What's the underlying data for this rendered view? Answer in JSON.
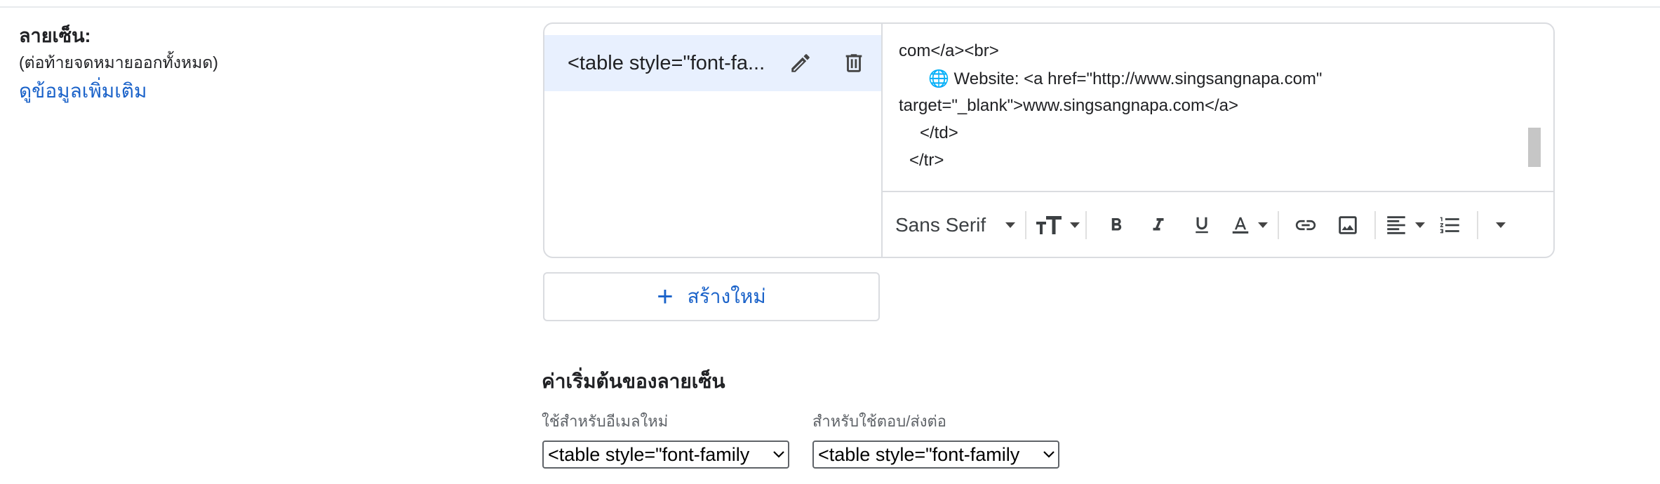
{
  "signature_section": {
    "title": "ลายเซ็น:",
    "subtitle": "(ต่อท้ายจดหมายออกทั้งหมด)",
    "learn_more": "ดูข้อมูลเพิ่มเติม"
  },
  "signature_list": {
    "items": [
      {
        "name": "<table style=\"font-fa..."
      }
    ],
    "create_label": "สร้างใหม่"
  },
  "editor": {
    "lines": [
      "com</a><br>",
      "🌐 Website: <a href=\"http://www.singsangnapa.com\"",
      "target=\"_blank\">www.singsangnapa.com</a>",
      "</td>",
      "</tr>"
    ],
    "toolbar": {
      "font": "Sans Serif",
      "icons": [
        "font-size-icon",
        "bold-icon",
        "italic-icon",
        "underline-icon",
        "text-color-icon",
        "link-icon",
        "image-icon",
        "align-icon",
        "numbered-list-icon",
        "more-options-icon"
      ]
    }
  },
  "defaults": {
    "title": "ค่าเริ่มต้นของลายเซ็น",
    "new_email_label": "ใช้สำหรับอีเมลใหม่",
    "new_email_value": "<table style=\"font-family",
    "reply_label": "สำหรับใช้ตอบ/ส่งต่อ",
    "reply_value": "<table style=\"font-family"
  },
  "colors": {
    "accent": "#1a62c9",
    "selected_bg": "#e8f0fe",
    "border": "#dadce0"
  }
}
